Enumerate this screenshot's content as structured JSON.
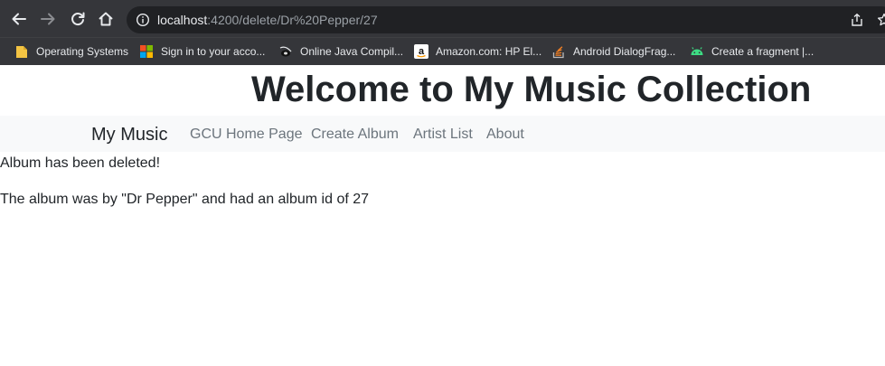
{
  "browser": {
    "url_host": "localhost",
    "url_path": ":4200/delete/Dr%20Pepper/27",
    "nav_icons": [
      "back-icon",
      "forward-icon",
      "reload-icon",
      "home-icon"
    ],
    "colors": {
      "chrome": "#35363a",
      "omnibox": "#202124",
      "text": "#e8eaed",
      "muted": "#9aa0a6"
    },
    "bookmarks": [
      {
        "label": "Operating Systems",
        "icon": "folder-icon"
      },
      {
        "label": "Sign in to your acco...",
        "icon": "microsoft-icon"
      },
      {
        "label": "Online Java Compil...",
        "icon": "java-icon"
      },
      {
        "label": "Amazon.com: HP El...",
        "icon": "amazon-icon"
      },
      {
        "label": "Android DialogFrag...",
        "icon": "stackoverflow-icon"
      },
      {
        "label": "Create a fragment  |...",
        "icon": "android-icon"
      }
    ]
  },
  "page": {
    "title": "Welcome to My Music Collection",
    "navbar": {
      "brand": "My Music",
      "links": [
        "GCU Home Page",
        "Create Album",
        "Artist List",
        "About"
      ]
    },
    "messages": [
      "Album has been deleted!",
      "The album was by \"Dr Pepper\" and had an album id of 27"
    ],
    "colors": {
      "title": "#212529",
      "navbar_bg": "#f8f9fa",
      "link": "#6c757d"
    }
  }
}
